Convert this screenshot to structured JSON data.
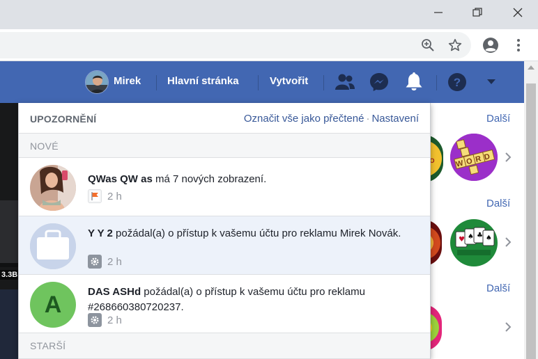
{
  "nav": {
    "user_name": "Mirek",
    "home_label": "Hlavní stránka",
    "create_label": "Vytvořit"
  },
  "notifications_panel": {
    "title": "UPOZORNĚNÍ",
    "mark_all_read": "Označit vše jako přečtené",
    "separator": "·",
    "settings": "Nastavení",
    "section_new": "NOVÉ",
    "section_older": "STARŠÍ",
    "items": [
      {
        "actor": "QWas QW as",
        "action": " má 7 nových zobrazení.",
        "time": "2 h",
        "avatar_letter": "",
        "meta_icon": "flag-icon",
        "unread": false
      },
      {
        "actor": "Y Y 2",
        "action": " požádal(a) o přístup k vašemu účtu pro reklamu Mirek Novák.",
        "time": "2 h",
        "avatar_letter": "",
        "meta_icon": "gear-icon",
        "unread": true
      },
      {
        "actor": "DAS ASHd",
        "action": " požádal(a) o přístup k vašemu účtu pro reklamu #268660380720237.",
        "time": "2 h",
        "avatar_letter": "A",
        "meta_icon": "gear-icon",
        "unread": false
      }
    ]
  },
  "side_panel": {
    "more_label": "Další",
    "game_word": "WORD"
  },
  "background": {
    "badge_text": "3.3B"
  },
  "colors": {
    "fb_blue": "#4267b2",
    "link_blue": "#385898",
    "unread_bg": "#edf2fa",
    "green_avatar": "#6fc45e"
  }
}
